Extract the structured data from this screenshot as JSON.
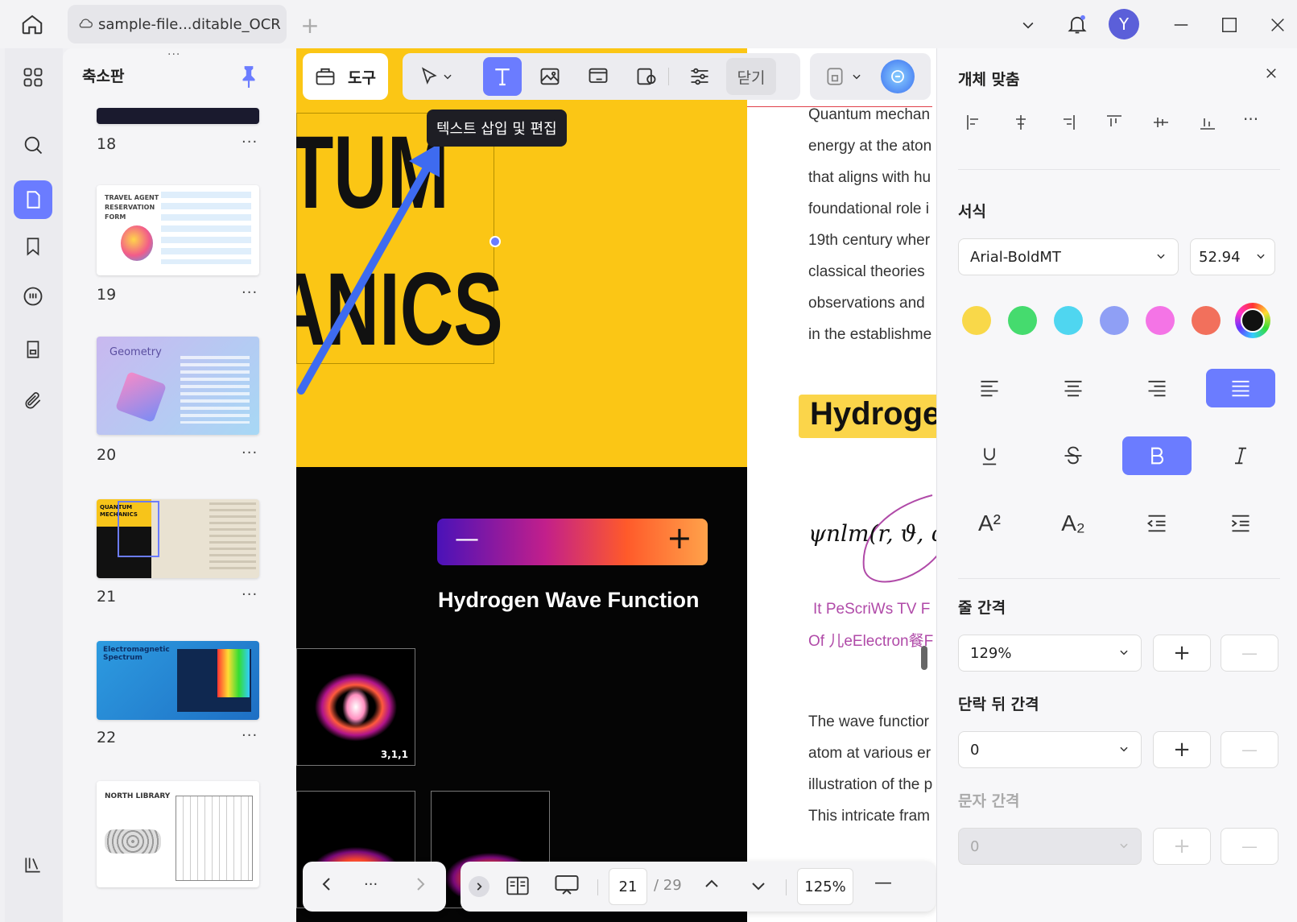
{
  "titlebar": {
    "tab_title": "sample-file...ditable_OCR",
    "avatar_letter": "Y"
  },
  "thumbnails": {
    "title": "축소판",
    "pages": [
      {
        "num": "18"
      },
      {
        "num": "19",
        "label": "TRAVEL AGENT RESERVATION FORM"
      },
      {
        "num": "20",
        "label": "Geometry"
      },
      {
        "num": "21",
        "label": "QUANTUM MECHANICS"
      },
      {
        "num": "22",
        "label": "Electromagnetic Spectrum"
      },
      {
        "label": "NORTH LIBRARY"
      }
    ],
    "more": "···"
  },
  "toolbar": {
    "tools_label": "도구",
    "close_label": "닫기",
    "tooltip": "텍스트 삽입 및 편집"
  },
  "page_left": {
    "big_word_1": "TUM",
    "big_word_2": "ANICS",
    "slider_minus": "—",
    "slider_plus": "+",
    "heading": "Hydrogen Wave Function",
    "plot_label": "3,1,1"
  },
  "page_right": {
    "lines_top": [
      "Quantum mechan",
      "energy at the aton",
      "that aligns with hu",
      "foundational role i",
      "19th century wher",
      "classical theories",
      "observations and",
      "in the establishme"
    ],
    "heading": "Hydroge",
    "formula": "ψnlm(r, ϑ, φ",
    "pink_1": "It PeScriWs TV F",
    "pink_2": "Of 儿eElectron餐F",
    "lines_bottom": [
      "The wave functior",
      "atom at various er",
      "illustration of the p",
      "This intricate fram"
    ]
  },
  "bottombar": {
    "more": "···",
    "page_current": "21",
    "page_total": "/ 29",
    "zoom": "125%",
    "zoom_out": "—"
  },
  "panel": {
    "align_title": "개체 맞춤",
    "format_title": "서식",
    "font_name": "Arial-BoldMT",
    "font_size": "52.94",
    "colors": [
      "#f9d849",
      "#45db6e",
      "#4fd6f0",
      "#8f9ff5",
      "#f474e6",
      "#f2705c",
      "#111111"
    ],
    "line_spacing_title": "줄 간격",
    "line_spacing_value": "129%",
    "para_spacing_title": "단락 뒤 간격",
    "para_spacing_value": "0",
    "char_spacing_title": "문자 간격",
    "char_spacing_value": "0",
    "plus": "+",
    "minus": "—",
    "super_label": "A²",
    "sub_label": "A₂"
  }
}
